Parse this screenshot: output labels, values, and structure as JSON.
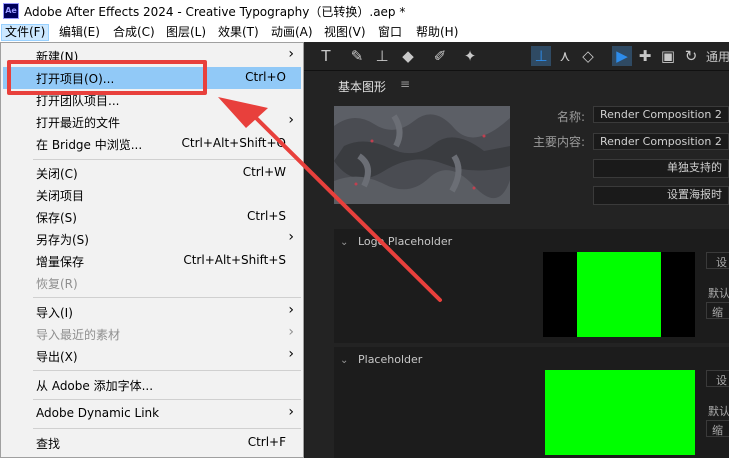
{
  "titlebar": {
    "icon_text": "Ae",
    "title": "Adobe After Effects 2024 - Creative Typography（已转换）.aep *"
  },
  "menubar": [
    {
      "label": "文件(F)"
    },
    {
      "label": "编辑(E)"
    },
    {
      "label": "合成(C)"
    },
    {
      "label": "图层(L)"
    },
    {
      "label": "效果(T)"
    },
    {
      "label": "动画(A)"
    },
    {
      "label": "视图(V)"
    },
    {
      "label": "窗口"
    },
    {
      "label": "帮助(H)"
    }
  ],
  "toolbar": {
    "workspace_label": "通用"
  },
  "panel": {
    "tab_label": "基本图形",
    "tab_menu_icon": "≡",
    "name_label": "名称:",
    "name_value": "Render Composition 2",
    "primary_label": "主要内容:",
    "primary_value": "Render Composition 2",
    "solo_button": "单独支持的",
    "poster_button": "设置海报时",
    "sections": [
      {
        "label": "Logo Placeholder"
      },
      {
        "label": "Placeholder"
      }
    ],
    "side_labels": {
      "s1a": "设",
      "s1b": "默认",
      "s1c": "缩",
      "s2a": "设",
      "s2b": "默认",
      "s2c": "缩"
    }
  },
  "file_menu": {
    "items": [
      {
        "label": "新建(N)",
        "shortcut": "",
        "submenu": true,
        "disabled": false
      },
      {
        "label": "打开项目(O)...",
        "shortcut": "Ctrl+O",
        "submenu": false,
        "disabled": false,
        "highlighted": true
      },
      {
        "label": "打开团队项目...",
        "shortcut": "",
        "submenu": false,
        "disabled": false
      },
      {
        "label": "打开最近的文件",
        "shortcut": "",
        "submenu": true,
        "disabled": false
      },
      {
        "label": "在 Bridge 中浏览...",
        "shortcut": "Ctrl+Alt+Shift+O",
        "submenu": false,
        "disabled": false
      },
      {
        "label": "关闭(C)",
        "shortcut": "Ctrl+W",
        "submenu": false,
        "disabled": false
      },
      {
        "label": "关闭项目",
        "shortcut": "",
        "submenu": false,
        "disabled": false
      },
      {
        "label": "保存(S)",
        "shortcut": "Ctrl+S",
        "submenu": false,
        "disabled": false
      },
      {
        "label": "另存为(S)",
        "shortcut": "",
        "submenu": true,
        "disabled": false
      },
      {
        "label": "增量保存",
        "shortcut": "Ctrl+Alt+Shift+S",
        "submenu": false,
        "disabled": false
      },
      {
        "label": "恢复(R)",
        "shortcut": "",
        "submenu": false,
        "disabled": true
      },
      {
        "label": "导入(I)",
        "shortcut": "",
        "submenu": true,
        "disabled": false
      },
      {
        "label": "导入最近的素材",
        "shortcut": "",
        "submenu": true,
        "disabled": true
      },
      {
        "label": "导出(X)",
        "shortcut": "",
        "submenu": true,
        "disabled": false
      },
      {
        "label": "从 Adobe 添加字体...",
        "shortcut": "",
        "submenu": false,
        "disabled": false
      },
      {
        "label": "Adobe Dynamic Link",
        "shortcut": "",
        "submenu": true,
        "disabled": false
      },
      {
        "label": "查找",
        "shortcut": "Ctrl+F",
        "submenu": false,
        "disabled": false
      }
    ]
  },
  "colors": {
    "annotation_red": "#e8403c",
    "menu_highlight": "#91c9f7",
    "placeholder_green": "#00ff00"
  }
}
